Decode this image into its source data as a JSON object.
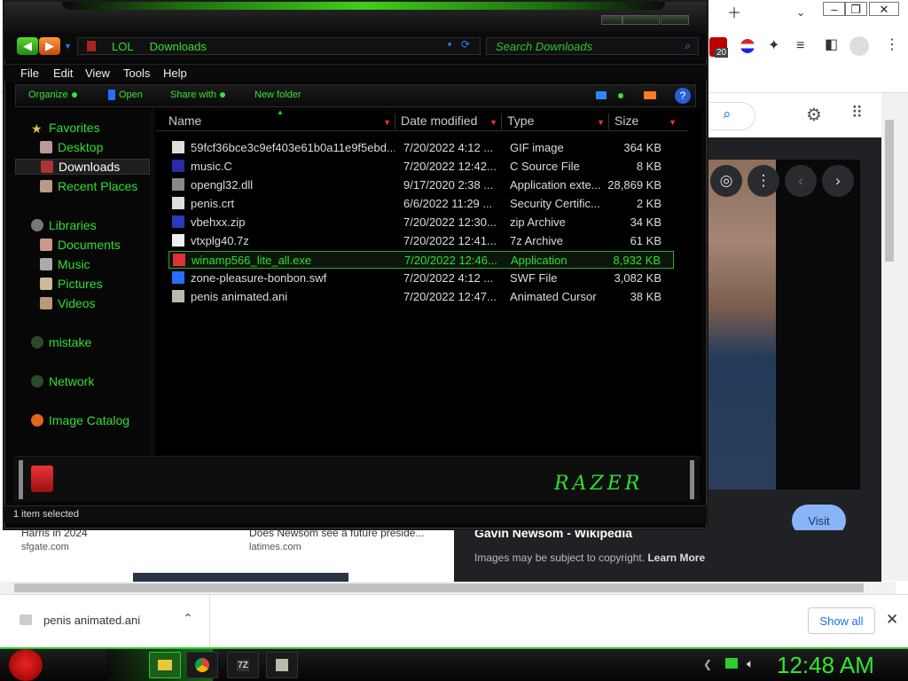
{
  "colors": {
    "accent_green": "#2ee02e",
    "sort_red": "#ff3030",
    "visit_blue": "#8ab4f8",
    "explorer_bg": "#000000"
  },
  "chrome": {
    "new_tab_icon": "plus-icon",
    "tab_menu_icon": "chevron-down-icon",
    "extension_badge": "20",
    "image_panel": {
      "title": "Gavin Newsom - Wikipedia",
      "copyright_text": "Images may be subject to copyright.",
      "learn_more": "Learn More",
      "visit": "Visit"
    },
    "results": [
      {
        "title": "Harris in 2024",
        "source": "sfgate.com"
      },
      {
        "title": "Does Newsom see a future preside...",
        "source": "latimes.com"
      }
    ]
  },
  "downloads": {
    "file": "penis animated.ani",
    "show_all": "Show all"
  },
  "explorer": {
    "breadcrumb": [
      "LOL",
      "Downloads"
    ],
    "search_placeholder": "Search Downloads",
    "menu": [
      "File",
      "Edit",
      "View",
      "Tools",
      "Help"
    ],
    "commands": {
      "organize": "Organize",
      "open": "Open",
      "share": "Share with",
      "new_folder": "New folder"
    },
    "nav": {
      "favorites": "Favorites",
      "desktop": "Desktop",
      "downloads": "Downloads",
      "recent": "Recent Places",
      "libraries": "Libraries",
      "documents": "Documents",
      "music": "Music",
      "pictures": "Pictures",
      "videos": "Videos",
      "mistake": "mistake",
      "network": "Network",
      "image_catalog": "Image Catalog"
    },
    "columns": {
      "name": "Name",
      "date": "Date modified",
      "type": "Type",
      "size": "Size"
    },
    "files": [
      {
        "name": "59fcf36bce3c9ef403e61b0a11e9f5ebd...",
        "date": "7/20/2022 4:12 ...",
        "type": "GIF image",
        "size": "364 KB"
      },
      {
        "name": "music.C",
        "date": "7/20/2022 12:42...",
        "type": "C Source File",
        "size": "8 KB"
      },
      {
        "name": "opengl32.dll",
        "date": "9/17/2020 2:38 ...",
        "type": "Application exte...",
        "size": "28,869 KB"
      },
      {
        "name": "penis.crt",
        "date": "6/6/2022 11:29 ...",
        "type": "Security Certific...",
        "size": "2 KB"
      },
      {
        "name": "vbehxx.zip",
        "date": "7/20/2022 12:30...",
        "type": "zip Archive",
        "size": "34 KB"
      },
      {
        "name": "vtxplg40.7z",
        "date": "7/20/2022 12:41...",
        "type": "7z Archive",
        "size": "61 KB"
      },
      {
        "name": "winamp566_lite_all.exe",
        "date": "7/20/2022 12:46...",
        "type": "Application",
        "size": "8,932 KB"
      },
      {
        "name": "zone-pleasure-bonbon.swf",
        "date": "7/20/2022 4:12 ...",
        "type": "SWF File",
        "size": "3,082 KB"
      },
      {
        "name": "penis animated.ani",
        "date": "7/20/2022 12:47...",
        "type": "Animated Cursor",
        "size": "38 KB"
      }
    ],
    "status": "1 item selected",
    "logo": "RAZER"
  },
  "taskbar": {
    "tray_badge": "7Z",
    "clock": "12:48 AM"
  }
}
